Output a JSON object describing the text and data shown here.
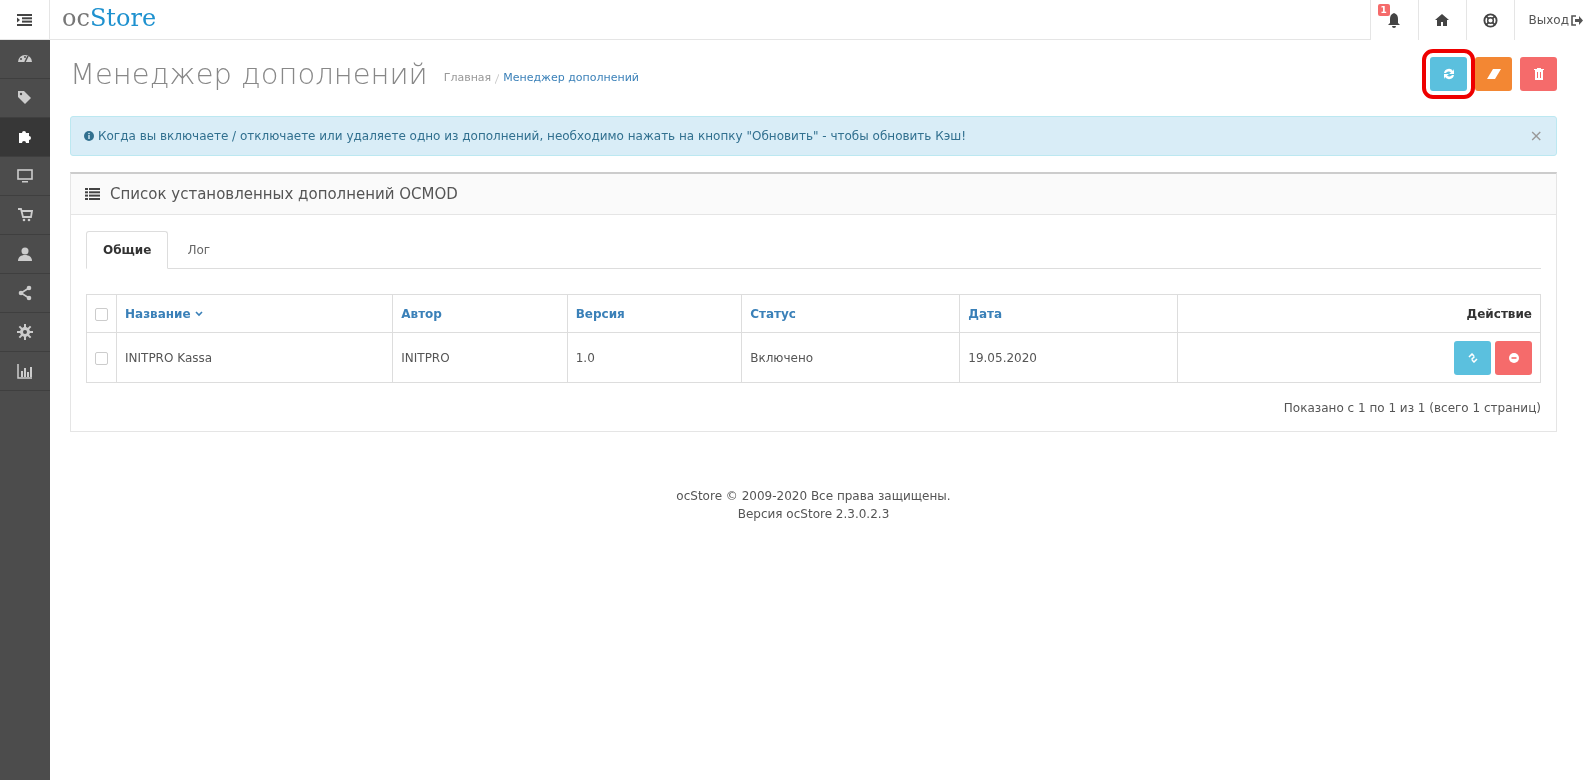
{
  "header": {
    "logo_prefix": "oc",
    "logo_main": "Store",
    "notification_count": "1",
    "logout": "Выход"
  },
  "sidebar": {
    "items": [
      {
        "selected": false
      },
      {
        "selected": false
      },
      {
        "selected": true
      },
      {
        "selected": false
      },
      {
        "selected": false
      },
      {
        "selected": false
      },
      {
        "selected": false
      },
      {
        "selected": false
      },
      {
        "selected": false
      }
    ]
  },
  "page": {
    "title": "Менеджер дополнений",
    "breadcrumbs": [
      {
        "label": "Главная",
        "current": false
      },
      {
        "label": "Менеджер дополнений",
        "current": true
      }
    ],
    "actions": [
      {
        "kind": "refresh",
        "highlighted": true
      },
      {
        "kind": "clear",
        "highlighted": false
      },
      {
        "kind": "delete",
        "highlighted": false
      }
    ]
  },
  "alert": {
    "text": "Когда вы включаете / отключаете или удаляете одно из дополнений, необходимо нажать на кнопку \"Обновить\" - чтобы обновить Кэш!",
    "close": "×"
  },
  "panel": {
    "title": "Список установленных дополнений OCMOD",
    "tabs": [
      {
        "label": "Общие",
        "selected": true
      },
      {
        "label": "Лог",
        "selected": false
      }
    ],
    "table": {
      "columns": [
        {
          "label": "Название",
          "sorted": true
        },
        {
          "label": "Автор",
          "sorted": false
        },
        {
          "label": "Версия",
          "sorted": false
        },
        {
          "label": "Статус",
          "sorted": false
        },
        {
          "label": "Дата",
          "sorted": false
        },
        {
          "label": "Действие",
          "sorted": false
        }
      ],
      "select_all_checked": false,
      "rows": [
        {
          "checked": false,
          "cells": [
            "INITPRO Kassa",
            "INITPRO",
            "1.0",
            "Включено",
            "19.05.2020"
          ]
        }
      ]
    },
    "pagination_text": "Показано с 1 по 1 из 1 (всего 1 страниц)"
  },
  "footer": {
    "brand": "ocStore",
    "line1": "© 2009-2020 Все права защищены.",
    "line2": "Версия ocStore 2.3.0.2.3"
  }
}
